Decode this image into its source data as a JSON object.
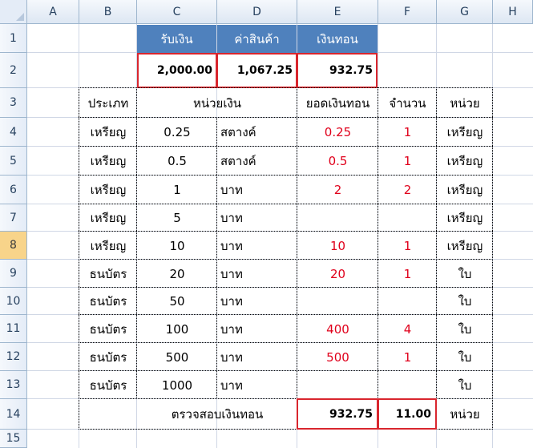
{
  "columns": [
    "A",
    "B",
    "C",
    "D",
    "E",
    "F",
    "G",
    "H"
  ],
  "rows": [
    "1",
    "2",
    "3",
    "4",
    "5",
    "6",
    "7",
    "8",
    "9",
    "10",
    "11",
    "12",
    "13",
    "14",
    "15"
  ],
  "header": {
    "received": "รับเงิน",
    "price": "ค่าสินค้า",
    "change": "เงินทอน"
  },
  "totals": {
    "received": "2,000.00",
    "price": "1,067.25",
    "change": "932.75"
  },
  "table_headers": {
    "type": "ประเภท",
    "unit_money": "หน่วยเงิน",
    "change_amount": "ยอดเงินทอน",
    "quantity": "จำนวน",
    "unit": "หน่วย"
  },
  "items": [
    {
      "type": "เหรียญ",
      "value": "0.25",
      "currency": "สตางค์",
      "amount": "0.25",
      "qty": "1",
      "unit": "เหรียญ"
    },
    {
      "type": "เหรียญ",
      "value": "0.5",
      "currency": "สตางค์",
      "amount": "0.5",
      "qty": "1",
      "unit": "เหรียญ"
    },
    {
      "type": "เหรียญ",
      "value": "1",
      "currency": "บาท",
      "amount": "2",
      "qty": "2",
      "unit": "เหรียญ"
    },
    {
      "type": "เหรียญ",
      "value": "5",
      "currency": "บาท",
      "amount": "",
      "qty": "",
      "unit": "เหรียญ"
    },
    {
      "type": "เหรียญ",
      "value": "10",
      "currency": "บาท",
      "amount": "10",
      "qty": "1",
      "unit": "เหรียญ"
    },
    {
      "type": "ธนบัตร",
      "value": "20",
      "currency": "บาท",
      "amount": "20",
      "qty": "1",
      "unit": "ใบ"
    },
    {
      "type": "ธนบัตร",
      "value": "50",
      "currency": "บาท",
      "amount": "",
      "qty": "",
      "unit": "ใบ"
    },
    {
      "type": "ธนบัตร",
      "value": "100",
      "currency": "บาท",
      "amount": "400",
      "qty": "4",
      "unit": "ใบ"
    },
    {
      "type": "ธนบัตร",
      "value": "500",
      "currency": "บาท",
      "amount": "500",
      "qty": "1",
      "unit": "ใบ"
    },
    {
      "type": "ธนบัตร",
      "value": "1000",
      "currency": "บาท",
      "amount": "",
      "qty": "",
      "unit": "ใบ"
    }
  ],
  "check": {
    "label": "ตรวจสอบเงินทอน",
    "amount": "932.75",
    "qty": "11.00",
    "unit": "หน่วย"
  },
  "selected_row": "8",
  "colors": {
    "header_fill": "#4f81bd",
    "highlight_border": "#d9262e",
    "red_text": "#e0001b",
    "selected_row_header": "#f8d48a"
  }
}
